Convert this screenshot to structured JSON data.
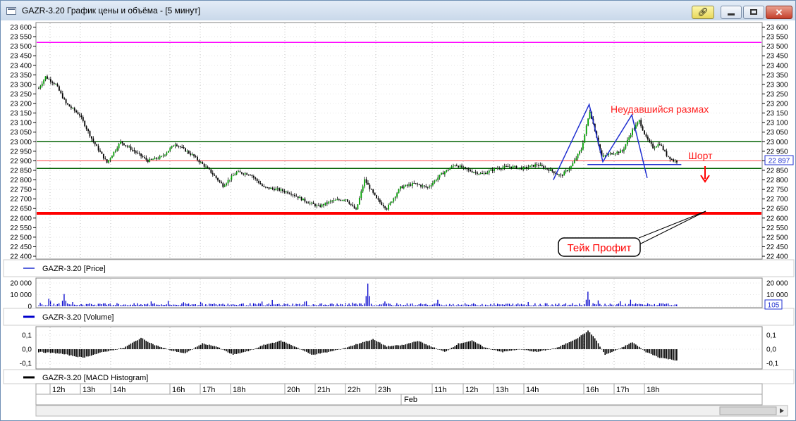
{
  "window": {
    "title": "GAZR-3.20 График цены и объёма - [5 минут]",
    "link_icon": "link-icon",
    "min_icon": "minimize-icon",
    "max_icon": "maximize-icon",
    "close_icon": "close-icon"
  },
  "chart_data": [
    {
      "type": "candlestick",
      "legend": "GAZR-3.20 [Price]",
      "ylim": [
        22400,
        23600
      ],
      "yticks": [
        "23 600",
        "23 550",
        "23 500",
        "23 450",
        "23 400",
        "23 350",
        "23 300",
        "23 250",
        "23 200",
        "23 150",
        "23 100",
        "23 050",
        "23 000",
        "22 950",
        "22 900",
        "22 850",
        "22 800",
        "22 750",
        "22 700",
        "22 650",
        "22 600",
        "22 550",
        "22 500",
        "22 450",
        "22 400"
      ],
      "last_price_label": "22 897",
      "colors": {
        "up": "#00a000",
        "down": "#000000"
      },
      "anchors": [
        [
          0,
          23280
        ],
        [
          4,
          23340
        ],
        [
          10,
          23300
        ],
        [
          16,
          23200
        ],
        [
          24,
          23140
        ],
        [
          32,
          23000
        ],
        [
          40,
          22890
        ],
        [
          48,
          23000
        ],
        [
          56,
          22950
        ],
        [
          64,
          22900
        ],
        [
          72,
          22920
        ],
        [
          80,
          22990
        ],
        [
          90,
          22930
        ],
        [
          100,
          22850
        ],
        [
          108,
          22770
        ],
        [
          116,
          22840
        ],
        [
          124,
          22830
        ],
        [
          132,
          22760
        ],
        [
          140,
          22750
        ],
        [
          148,
          22730
        ],
        [
          156,
          22690
        ],
        [
          164,
          22660
        ],
        [
          172,
          22690
        ],
        [
          180,
          22700
        ],
        [
          186,
          22640
        ],
        [
          191,
          22800
        ],
        [
          198,
          22700
        ],
        [
          204,
          22650
        ],
        [
          212,
          22760
        ],
        [
          220,
          22780
        ],
        [
          228,
          22760
        ],
        [
          236,
          22830
        ],
        [
          244,
          22880
        ],
        [
          252,
          22850
        ],
        [
          260,
          22830
        ],
        [
          268,
          22860
        ],
        [
          276,
          22870
        ],
        [
          284,
          22860
        ],
        [
          292,
          22880
        ],
        [
          300,
          22850
        ],
        [
          306,
          22820
        ],
        [
          312,
          22870
        ],
        [
          318,
          22960
        ],
        [
          323,
          23160
        ],
        [
          326,
          23060
        ],
        [
          330,
          22920
        ],
        [
          336,
          22940
        ],
        [
          342,
          22950
        ],
        [
          348,
          23060
        ],
        [
          352,
          23110
        ],
        [
          356,
          23020
        ],
        [
          360,
          22970
        ],
        [
          364,
          22990
        ],
        [
          368,
          22930
        ],
        [
          372,
          22900
        ],
        [
          374,
          22897
        ]
      ],
      "hlines": [
        {
          "value": 23520,
          "color": "#ff00ff",
          "width": 1.5
        },
        {
          "value": 23000,
          "color": "#006000",
          "width": 1.5
        },
        {
          "value": 22900,
          "color": "#ff4040",
          "width": 1
        },
        {
          "value": 22860,
          "color": "#006000",
          "width": 1.5
        },
        {
          "value": 22625,
          "color": "#ff0000",
          "width": 4
        }
      ],
      "drawings": [
        {
          "points": [
            [
              302,
              22800
            ],
            [
              323,
              23195
            ],
            [
              331,
              22895
            ],
            [
              348,
              23140
            ],
            [
              357,
              22810
            ]
          ],
          "color": "#2030d0"
        },
        {
          "points": [
            [
              322,
              22880
            ],
            [
              377,
              22880
            ]
          ],
          "color": "#2030d0"
        }
      ],
      "annotations": [
        {
          "text": "Неудавшийся размах",
          "color": "#ff2020"
        },
        {
          "text": "Шорт",
          "color": "#ff2020"
        },
        {
          "text": "Тейк Профит",
          "color": "#ff0000"
        }
      ]
    },
    {
      "type": "bar",
      "legend": "GAZR-3.20 [Volume]",
      "ylim": [
        0,
        23000
      ],
      "yticks": [
        "20 000",
        "10 000",
        "0"
      ],
      "last_label": "105",
      "peaks": [
        [
          15,
          10500
        ],
        [
          193,
          19500
        ],
        [
          322,
          12500
        ]
      ],
      "color": "#0000cc"
    },
    {
      "type": "bar",
      "legend": "GAZR-3.20 [MACD Histogram]",
      "ylim": [
        -0.13,
        0.15
      ],
      "yticks": [
        "0,1",
        "0,0",
        "-0,1"
      ],
      "anchors": [
        [
          0,
          -0.02
        ],
        [
          12,
          -0.03
        ],
        [
          26,
          -0.06
        ],
        [
          38,
          -0.02
        ],
        [
          50,
          0.01
        ],
        [
          60,
          0.08
        ],
        [
          68,
          0.03
        ],
        [
          78,
          -0.01
        ],
        [
          86,
          -0.03
        ],
        [
          96,
          0.04
        ],
        [
          104,
          0.02
        ],
        [
          114,
          -0.04
        ],
        [
          124,
          -0.01
        ],
        [
          132,
          0.03
        ],
        [
          142,
          0.06
        ],
        [
          152,
          0.01
        ],
        [
          160,
          -0.04
        ],
        [
          170,
          -0.02
        ],
        [
          180,
          0.01
        ],
        [
          190,
          0.05
        ],
        [
          196,
          0.07
        ],
        [
          204,
          0.02
        ],
        [
          214,
          0.03
        ],
        [
          222,
          0.06
        ],
        [
          230,
          0.02
        ],
        [
          238,
          -0.02
        ],
        [
          246,
          0.04
        ],
        [
          254,
          0.06
        ],
        [
          262,
          0.01
        ],
        [
          272,
          -0.02
        ],
        [
          282,
          0.0
        ],
        [
          292,
          -0.02
        ],
        [
          304,
          0.01
        ],
        [
          316,
          0.08
        ],
        [
          322,
          0.13
        ],
        [
          326,
          0.08
        ],
        [
          332,
          -0.04
        ],
        [
          340,
          0.0
        ],
        [
          348,
          0.05
        ],
        [
          356,
          -0.02
        ],
        [
          364,
          -0.06
        ],
        [
          374,
          -0.08
        ]
      ],
      "color": "#000000"
    }
  ],
  "time_axis": {
    "hours": [
      "12h",
      "13h",
      "14h",
      "16h",
      "17h",
      "18h",
      "20h",
      "21h",
      "22h",
      "23h",
      "11h",
      "12h",
      "13h",
      "14h",
      "16h",
      "17h",
      "18h"
    ],
    "date_label": "Feb"
  }
}
